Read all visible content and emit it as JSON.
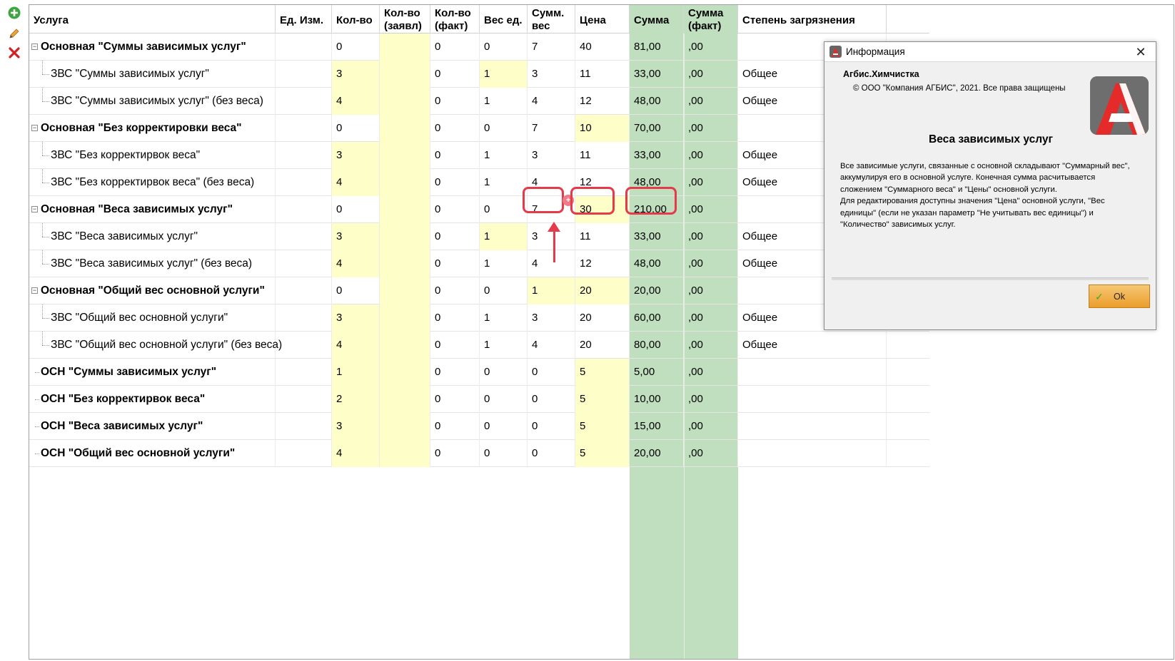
{
  "toolbar": {
    "add_icon": "add-icon",
    "edit_icon": "edit-icon",
    "delete_icon": "delete-icon"
  },
  "colors": {
    "yellow_cell": "#fefec8",
    "green_column": "#bfdfbf",
    "highlight": "#e43a4a",
    "ok_button": "#efae45"
  },
  "columns": [
    {
      "key": "service",
      "label": "Услуга"
    },
    {
      "key": "unit",
      "label": "Ед. Изм."
    },
    {
      "key": "qty",
      "label": "Кол-во"
    },
    {
      "key": "qty_decl",
      "label": "Кол-во (заявл)"
    },
    {
      "key": "qty_fact",
      "label": "Кол-во (факт)"
    },
    {
      "key": "unit_weight",
      "label": "Вес ед."
    },
    {
      "key": "sum_weight",
      "label": "Сумм. вес"
    },
    {
      "key": "price",
      "label": "Цена"
    },
    {
      "key": "sum",
      "label": "Сумма"
    },
    {
      "key": "sum_fact",
      "label": "Сумма (факт)"
    },
    {
      "key": "soil",
      "label": "Степень загрязнения"
    }
  ],
  "rows": [
    {
      "name": "Основная \"Суммы зависимых услуг\"",
      "bold": true,
      "expander": "-",
      "qty": "0",
      "qty_fact": "0",
      "unit_weight": "0",
      "sum_weight": "7",
      "price": "40",
      "sum": "81,00",
      "sum_fact": ",00",
      "soil": "",
      "y_qty": false,
      "y_w": false,
      "y_p": false
    },
    {
      "name": "ЗВС \"Суммы зависимых услуг\"",
      "bold": false,
      "child": true,
      "qty": "3",
      "qty_fact": "0",
      "unit_weight": "1",
      "sum_weight": "3",
      "price": "11",
      "sum": "33,00",
      "sum_fact": ",00",
      "soil": "Общее",
      "y_qty": true,
      "y_w": true,
      "y_p": false
    },
    {
      "name": "ЗВС \"Суммы зависимых услуг\" (без веса)",
      "bold": false,
      "child": true,
      "qty": "4",
      "qty_fact": "0",
      "unit_weight": "1",
      "sum_weight": "4",
      "price": "12",
      "sum": "48,00",
      "sum_fact": ",00",
      "soil": "Общее",
      "y_qty": true,
      "y_w": false,
      "y_p": false
    },
    {
      "name": "Основная \"Без корректировки веса\"",
      "bold": true,
      "expander": "-",
      "qty": "0",
      "qty_fact": "0",
      "unit_weight": "0",
      "sum_weight": "7",
      "price": "10",
      "sum": "70,00",
      "sum_fact": ",00",
      "soil": "",
      "y_qty": false,
      "y_w": false,
      "y_p": true
    },
    {
      "name": "ЗВС \"Без корректирвок веса\"",
      "bold": false,
      "child": true,
      "qty": "3",
      "qty_fact": "0",
      "unit_weight": "1",
      "sum_weight": "3",
      "price": "11",
      "sum": "33,00",
      "sum_fact": ",00",
      "soil": "Общее",
      "y_qty": true,
      "y_w": false,
      "y_p": false
    },
    {
      "name": "ЗВС \"Без корректирвок веса\" (без веса)",
      "bold": false,
      "child": true,
      "qty": "4",
      "qty_fact": "0",
      "unit_weight": "1",
      "sum_weight": "4",
      "price": "12",
      "sum": "48,00",
      "sum_fact": ",00",
      "soil": "Общее",
      "y_qty": true,
      "y_w": false,
      "y_p": false
    },
    {
      "name": "Основная \"Веса зависимых услуг\"",
      "bold": true,
      "expander": "-",
      "qty": "0",
      "qty_fact": "0",
      "unit_weight": "0",
      "sum_weight": "7",
      "price": "30",
      "sum": "210,00",
      "sum_fact": ",00",
      "soil": "",
      "y_qty": false,
      "y_w": false,
      "y_p": true
    },
    {
      "name": "ЗВС \"Веса зависимых услуг\"",
      "bold": false,
      "child": true,
      "qty": "3",
      "qty_fact": "0",
      "unit_weight": "1",
      "sum_weight": "3",
      "price": "11",
      "sum": "33,00",
      "sum_fact": ",00",
      "soil": "Общее",
      "y_qty": true,
      "y_w": true,
      "y_p": false
    },
    {
      "name": "ЗВС \"Веса зависимых услуг\" (без веса)",
      "bold": false,
      "child": true,
      "qty": "4",
      "qty_fact": "0",
      "unit_weight": "1",
      "sum_weight": "4",
      "price": "12",
      "sum": "48,00",
      "sum_fact": ",00",
      "soil": "Общее",
      "y_qty": true,
      "y_w": false,
      "y_p": false
    },
    {
      "name": "Основная \"Общий вес основной услуги\"",
      "bold": true,
      "expander": "-",
      "qty": "0",
      "qty_fact": "0",
      "unit_weight": "0",
      "sum_weight": "1",
      "price": "20",
      "sum": "20,00",
      "sum_fact": ",00",
      "soil": "",
      "y_qty": false,
      "y_w": false,
      "y_sw": true,
      "y_p": true
    },
    {
      "name": "ЗВС \"Общий вес основной услуги\"",
      "bold": false,
      "child": true,
      "qty": "3",
      "qty_fact": "0",
      "unit_weight": "1",
      "sum_weight": "3",
      "price": "20",
      "sum": "60,00",
      "sum_fact": ",00",
      "soil": "Общее",
      "y_qty": true,
      "y_w": false,
      "y_p": false
    },
    {
      "name": "ЗВС \"Общий вес основной услуги\" (без веса)",
      "bold": false,
      "child": true,
      "qty": "4",
      "qty_fact": "0",
      "unit_weight": "1",
      "sum_weight": "4",
      "price": "20",
      "sum": "80,00",
      "sum_fact": ",00",
      "soil": "Общее",
      "y_qty": true,
      "y_w": false,
      "y_p": false
    },
    {
      "name": "ОСН \"Суммы зависимых услуг\"",
      "bold": true,
      "qty": "1",
      "qty_fact": "0",
      "unit_weight": "0",
      "sum_weight": "0",
      "price": "5",
      "sum": "5,00",
      "sum_fact": ",00",
      "soil": "",
      "y_qty": true,
      "y_w": false,
      "y_p": true
    },
    {
      "name": "ОСН \"Без корректирвок веса\"",
      "bold": true,
      "qty": "2",
      "qty_fact": "0",
      "unit_weight": "0",
      "sum_weight": "0",
      "price": "5",
      "sum": "10,00",
      "sum_fact": ",00",
      "soil": "",
      "y_qty": true,
      "y_w": false,
      "y_p": true
    },
    {
      "name": "ОСН \"Веса зависимых услуг\"",
      "bold": true,
      "qty": "3",
      "qty_fact": "0",
      "unit_weight": "0",
      "sum_weight": "0",
      "price": "5",
      "sum": "15,00",
      "sum_fact": ",00",
      "soil": "",
      "y_qty": true,
      "y_w": false,
      "y_p": true
    },
    {
      "name": "ОСН \"Общий вес основной услуги\"",
      "bold": true,
      "qty": "4",
      "qty_fact": "0",
      "unit_weight": "0",
      "sum_weight": "0",
      "price": "5",
      "sum": "20,00",
      "sum_fact": ",00",
      "soil": "",
      "y_qty": true,
      "y_w": false,
      "y_p": true
    }
  ],
  "annotation": {
    "plus_symbol": "+"
  },
  "dialog": {
    "title": "Информация",
    "close_symbol": "✕",
    "app_name": "Агбис.Химчистка",
    "copyright": "© ООО \"Компания АГБИС\", 2021. Все права защищены",
    "heading": "Веса зависимых услуг",
    "body_lines": [
      "Все зависимые услуги, связанные с основной складывают \"Суммарный вес\",",
      "аккумулируя его в основной услуге. Конечная сумма расчитывается",
      "сложением \"Суммарного веса\" и \"Цены\" основной услуги.",
      "Для редактирования доступны значения \"Цена\" основной услуги, \"Вес",
      "единицы\" (если не указан параметр \"Не учитывать вес единицы\") и",
      "\"Количество\" зависимых услуг."
    ],
    "ok_label": "Ok",
    "check_symbol": "✓"
  }
}
